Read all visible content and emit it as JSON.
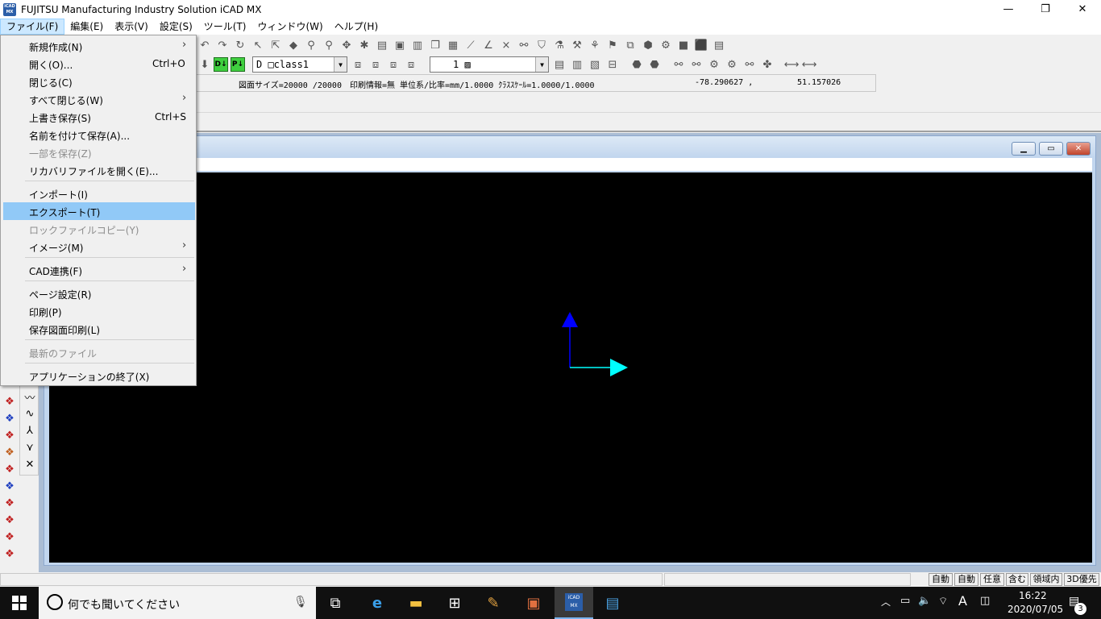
{
  "window": {
    "title": "FUJITSU Manufacturing Industry Solution iCAD MX",
    "app_icon_text": "iCAD MX",
    "minimize_glyph": "—",
    "maximize_glyph": "❐",
    "close_glyph": "✕"
  },
  "menubar": {
    "items": [
      {
        "label": "ファイル(F)"
      },
      {
        "label": "編集(E)"
      },
      {
        "label": "表示(V)"
      },
      {
        "label": "設定(S)"
      },
      {
        "label": "ツール(T)"
      },
      {
        "label": "ウィンドウ(W)"
      },
      {
        "label": "ヘルプ(H)"
      }
    ]
  },
  "toolbar2": {
    "green_btn_1": "D↓",
    "green_btn_2": "P↓",
    "layer_combo": "D □class1",
    "style_combo": "1 ▨"
  },
  "infobar": {
    "info_text": "図面サイズ=20000 /20000　印刷情報=無 単位系/比率=mm/1.0000 ｸﾗｽｽｹｰﾙ=1.0000/1.0000",
    "coord_x": "-78.290627 ,",
    "coord_y": "51.157026"
  },
  "file_menu": {
    "items": [
      {
        "label": "新規作成(N)",
        "accel": "",
        "submenu": true,
        "disabled": false
      },
      {
        "label": "開く(O)...",
        "accel": "Ctrl+O",
        "submenu": false,
        "disabled": false
      },
      {
        "label": "閉じる(C)",
        "accel": "",
        "submenu": false,
        "disabled": false
      },
      {
        "label": "すべて閉じる(W)",
        "accel": "",
        "submenu": true,
        "disabled": false
      },
      {
        "label": "上書き保存(S)",
        "accel": "Ctrl+S",
        "submenu": false,
        "disabled": false
      },
      {
        "label": "名前を付けて保存(A)...",
        "accel": "",
        "submenu": false,
        "disabled": false
      },
      {
        "label": "一部を保存(Z)",
        "accel": "",
        "submenu": false,
        "disabled": true
      },
      {
        "label": "リカバリファイルを開く(E)...",
        "accel": "",
        "submenu": false,
        "disabled": false
      },
      {
        "label": "インポート(I)",
        "accel": "",
        "submenu": false,
        "disabled": false
      },
      {
        "label": "エクスポート(T)",
        "accel": "",
        "submenu": false,
        "disabled": false,
        "highlighted": true
      },
      {
        "label": "ロックファイルコピー(Y)",
        "accel": "",
        "submenu": false,
        "disabled": true
      },
      {
        "label": "イメージ(M)",
        "accel": "",
        "submenu": true,
        "disabled": false
      },
      {
        "label": "CAD連携(F)",
        "accel": "",
        "submenu": true,
        "disabled": false
      },
      {
        "label": "ページ設定(R)",
        "accel": "",
        "submenu": false,
        "disabled": false
      },
      {
        "label": "印刷(P)",
        "accel": "",
        "submenu": false,
        "disabled": false
      },
      {
        "label": "保存図面印刷(L)",
        "accel": "",
        "submenu": false,
        "disabled": false
      },
      {
        "label": "最新のファイル",
        "accel": "",
        "submenu": false,
        "disabled": true
      },
      {
        "label": "アプリケーションの終了(X)",
        "accel": "",
        "submenu": false,
        "disabled": false
      }
    ],
    "submenu_glyph": "›"
  },
  "statusbar": {
    "buttons": [
      "自動",
      "自動",
      "任意",
      "含む",
      "領域内",
      "3D優先"
    ]
  },
  "canvas": {
    "axis_y_color": "#0000ff",
    "axis_x_color": "#00ffff"
  },
  "taskbar": {
    "search_placeholder": "何でも聞いてください",
    "ime_indicator": "A",
    "clock_time": "16:22",
    "clock_date": "2020/07/05",
    "notification_count": "3"
  }
}
